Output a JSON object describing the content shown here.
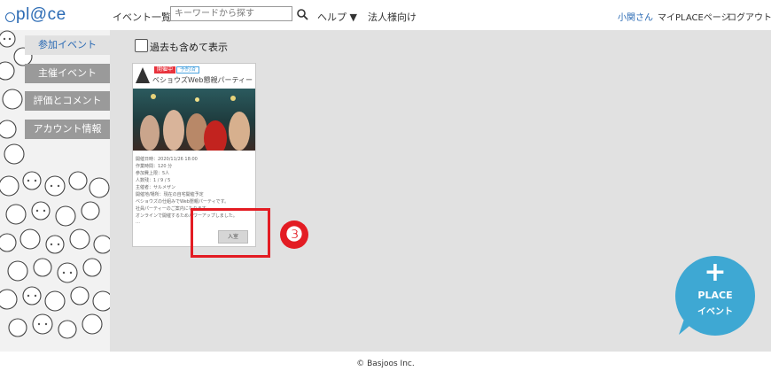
{
  "header": {
    "logo": "pl@ce",
    "nav": {
      "events": "イベント一覧",
      "help": "ヘルプ ▼",
      "corporate": "法人様向け"
    },
    "search": {
      "placeholder": "キーワードから探す"
    },
    "user": {
      "name": "小関さん",
      "mypage": "マイPLACEページ",
      "logout": "ログアウト"
    }
  },
  "sidebar": {
    "tabs": [
      {
        "label": "参加イベント",
        "active": true
      },
      {
        "label": "主催イベント",
        "active": false
      },
      {
        "label": "評価とコメント",
        "active": false
      },
      {
        "label": "アカウント情報",
        "active": false
      }
    ]
  },
  "main": {
    "show_past_label": "過去も含めて表示",
    "card": {
      "badges": [
        "開催中",
        "予約済"
      ],
      "title": "ベショウズWeb懇親パーティー",
      "details": [
        "開催日時：2020/11/26 18:00",
        "作業時間：120 分",
        "参加費上限：5人",
        "人数残：1 / 9 / 5",
        "主催者：サルメザン",
        "開催地/場所：現在の自宅開催予定",
        "ベショウズの仕組みでWeb懇親パーティです。",
        "社員パーティーのご案内になります。",
        "オンラインで開催するためパワーアップしました。",
        "…"
      ],
      "join_label": "入室"
    },
    "step_number": "❸"
  },
  "fab": {
    "plus": "+",
    "line1": "PLACE",
    "line2": "イベント"
  },
  "footer": {
    "copyright": "© Basjoos Inc."
  },
  "colors": {
    "accent": "#2a6ab4",
    "highlight": "#e31c23",
    "fab": "#3ea8d3"
  }
}
